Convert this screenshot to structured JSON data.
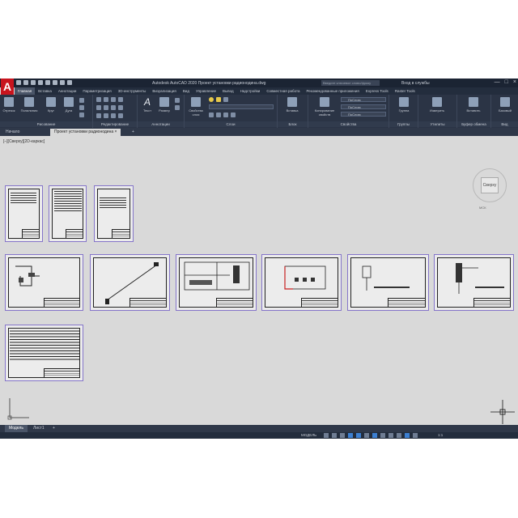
{
  "titlebar": {
    "logo": "A",
    "title": "Autodesk AutoCAD 2020   Проект установки радионодина.dwg",
    "search_placeholder": "Введите ключевое слово/фразу",
    "signin": "Вход в службы",
    "controls": [
      "—",
      "□",
      "×"
    ]
  },
  "ribbon_tabs": [
    "Главная",
    "Вставка",
    "Аннотации",
    "Параметризация",
    "3D-инструменты",
    "Визуализация",
    "Вид",
    "Управление",
    "Вывод",
    "Надстройки",
    "Совместная работа",
    "Рекомендованные приложения",
    "Express Tools",
    "Raster Tools"
  ],
  "ribbon": {
    "draw": {
      "label": "Рисование",
      "buttons": [
        "Отрезок",
        "Полилиния",
        "Круг",
        "Дуга"
      ]
    },
    "modify": {
      "label": "Редактирование"
    },
    "annotation": {
      "label": "Аннотации",
      "buttons": [
        "Текст",
        "Размер"
      ]
    },
    "layers": {
      "label": "Слои",
      "buttons": [
        "Свойства слоя"
      ]
    },
    "block": {
      "label": "Блок",
      "buttons": [
        "Вставка"
      ]
    },
    "properties": {
      "label": "Свойства",
      "buttons": [
        "Копирование свойств"
      ],
      "combos": [
        "ПоСлою",
        "ПоСлою",
        "ПоСлою"
      ]
    },
    "groups": {
      "label": "Группы",
      "buttons": [
        "Группа"
      ]
    },
    "utilities": {
      "label": "Утилиты",
      "buttons": [
        "Измерить"
      ]
    },
    "clipboard": {
      "label": "Буфер обмена",
      "buttons": [
        "Вставить"
      ]
    },
    "view": {
      "label": "Вид",
      "buttons": [
        "Базовый"
      ]
    }
  },
  "file_tabs": [
    "Начало",
    "Проект установки радионодина",
    "+"
  ],
  "viewport_label": "[–][Сверху][2D-каркас]",
  "viewcube": {
    "face": "Сверху",
    "wcs": "МСК"
  },
  "layout_tabs": [
    "Модель",
    "Лист1",
    "+"
  ],
  "status": {
    "model": "МОДЕЛЬ",
    "scale": "1:1"
  }
}
